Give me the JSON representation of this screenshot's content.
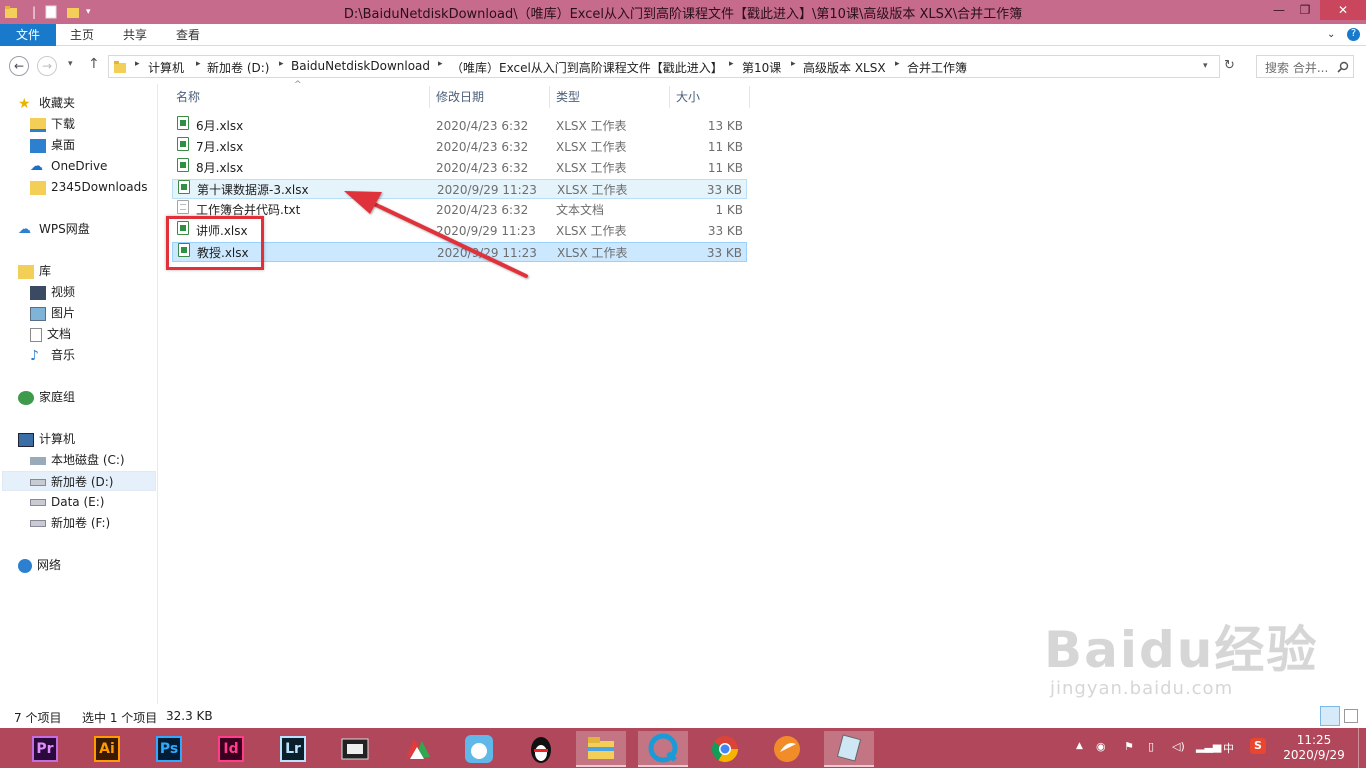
{
  "window": {
    "title": "D:\\BaiduNetdiskDownload\\（唯库）Excel从入门到高阶课程文件【戳此进入】\\第10课\\高级版本 XLSX\\合并工作簿"
  },
  "ribbon": {
    "tabs": [
      "文件",
      "主页",
      "共享",
      "查看"
    ]
  },
  "address": {
    "crumbs": [
      "计算机",
      "新加卷 (D:)",
      "BaiduNetdiskDownload",
      "（唯库）Excel从入门到高阶课程文件【戳此进入】",
      "第10课",
      "高级版本 XLSX",
      "合并工作簿"
    ],
    "search_placeholder": "搜索 合并..."
  },
  "nav": {
    "favorites": "收藏夹",
    "fav_items": [
      "下载",
      "桌面",
      "OneDrive",
      "2345Downloads"
    ],
    "wps": "WPS网盘",
    "library": "库",
    "lib_items": [
      "视频",
      "图片",
      "文档",
      "音乐"
    ],
    "homegroup": "家庭组",
    "computer": "计算机",
    "drives": [
      "本地磁盘 (C:)",
      "新加卷 (D:)",
      "Data (E:)",
      "新加卷 (F:)"
    ],
    "network": "网络"
  },
  "columns": {
    "name": "名称",
    "date": "修改日期",
    "type": "类型",
    "size": "大小"
  },
  "files": [
    {
      "name": "6月.xlsx",
      "date": "2020/4/23 6:32",
      "type": "XLSX 工作表",
      "size": "13 KB",
      "icon": "excel-file-icon"
    },
    {
      "name": "7月.xlsx",
      "date": "2020/4/23 6:32",
      "type": "XLSX 工作表",
      "size": "11 KB",
      "icon": "excel-file-icon"
    },
    {
      "name": "8月.xlsx",
      "date": "2020/4/23 6:32",
      "type": "XLSX 工作表",
      "size": "11 KB",
      "icon": "excel-file-icon"
    },
    {
      "name": "第十课数据源-3.xlsx",
      "date": "2020/9/29 11:23",
      "type": "XLSX 工作表",
      "size": "33 KB",
      "icon": "excel-file-icon"
    },
    {
      "name": "工作簿合并代码.txt",
      "date": "2020/4/23 6:32",
      "type": "文本文档",
      "size": "1 KB",
      "icon": "text-file-icon"
    },
    {
      "name": "讲师.xlsx",
      "date": "2020/9/29 11:23",
      "type": "XLSX 工作表",
      "size": "33 KB",
      "icon": "excel-file-icon"
    },
    {
      "name": "教授.xlsx",
      "date": "2020/9/29 11:23",
      "type": "XLSX 工作表",
      "size": "33 KB",
      "icon": "excel-file-icon"
    }
  ],
  "status": {
    "count": "7 个项目",
    "selected": "选中 1 个项目",
    "size": "32.3 KB"
  },
  "taskbar": {
    "apps": [
      "Pr",
      "Ai",
      "Ps",
      "Id",
      "Lr"
    ],
    "time": "11:25",
    "date": "2020/9/29",
    "ime": "中"
  },
  "watermark": {
    "text1": "Baidu经验",
    "text2": "jingyan.baidu.com"
  }
}
